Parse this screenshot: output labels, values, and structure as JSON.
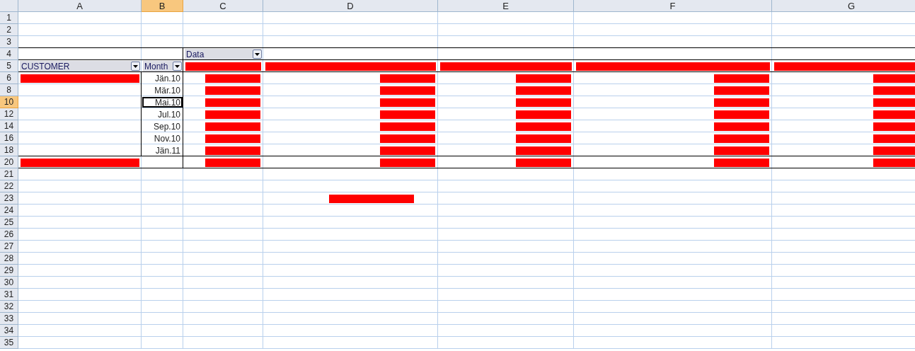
{
  "columns": [
    {
      "label": "A",
      "selected": false
    },
    {
      "label": "B",
      "selected": true
    },
    {
      "label": "C",
      "selected": false
    },
    {
      "label": "D",
      "selected": false
    },
    {
      "label": "E",
      "selected": false
    },
    {
      "label": "F",
      "selected": false
    },
    {
      "label": "G",
      "selected": false
    }
  ],
  "rows": [
    {
      "number": "1",
      "selected": false
    },
    {
      "number": "2",
      "selected": false
    },
    {
      "number": "3",
      "selected": false
    },
    {
      "number": "4",
      "selected": false,
      "cells": [
        null,
        null,
        {
          "kind": "field",
          "text": "Data",
          "selected": false
        }
      ]
    },
    {
      "number": "5",
      "selected": false,
      "cells": [
        {
          "kind": "field",
          "text": "CUSTOMER",
          "selected": false
        },
        {
          "kind": "field",
          "text": "Month",
          "selected": false
        },
        {
          "kind": "redacted",
          "selected": false
        },
        {
          "kind": "redacted",
          "selected": false
        },
        {
          "kind": "redacted",
          "selected": false
        },
        {
          "kind": "redacted",
          "selected": false
        },
        {
          "kind": "redacted",
          "selected": false
        }
      ]
    },
    {
      "number": "6",
      "selected": false,
      "cells": [
        {
          "kind": "redacted",
          "selected": false
        },
        {
          "kind": "date",
          "text": "Jän.10",
          "selected": false
        },
        {
          "kind": "redacted",
          "selected": false
        },
        {
          "kind": "redacted",
          "selected": false
        },
        {
          "kind": "redacted",
          "selected": false
        },
        {
          "kind": "redacted",
          "selected": false
        },
        {
          "kind": "redacted",
          "selected": false
        }
      ]
    },
    {
      "number": "8",
      "selected": false,
      "cells": [
        null,
        {
          "kind": "date",
          "text": "Mär.10",
          "selected": false
        },
        {
          "kind": "redacted",
          "selected": false
        },
        {
          "kind": "redacted",
          "selected": false
        },
        {
          "kind": "redacted",
          "selected": false
        },
        {
          "kind": "redacted",
          "selected": false
        },
        {
          "kind": "redacted",
          "selected": false
        }
      ]
    },
    {
      "number": "10",
      "selected": true,
      "cells": [
        null,
        {
          "kind": "date",
          "text": "Mai.10",
          "selected": true
        },
        {
          "kind": "redacted",
          "selected": false
        },
        {
          "kind": "redacted",
          "selected": false
        },
        {
          "kind": "redacted",
          "selected": false
        },
        {
          "kind": "redacted",
          "selected": false
        },
        {
          "kind": "redacted",
          "selected": false
        }
      ]
    },
    {
      "number": "12",
      "selected": false,
      "cells": [
        null,
        {
          "kind": "date",
          "text": "Jul.10",
          "selected": false
        },
        {
          "kind": "redacted",
          "selected": false
        },
        {
          "kind": "redacted",
          "selected": false
        },
        {
          "kind": "redacted",
          "selected": false
        },
        {
          "kind": "redacted",
          "selected": false
        },
        {
          "kind": "redacted",
          "selected": false
        }
      ]
    },
    {
      "number": "14",
      "selected": false,
      "cells": [
        null,
        {
          "kind": "date",
          "text": "Sep.10",
          "selected": false
        },
        {
          "kind": "redacted",
          "selected": false
        },
        {
          "kind": "redacted",
          "selected": false
        },
        {
          "kind": "redacted",
          "selected": false
        },
        {
          "kind": "redacted",
          "selected": false
        },
        {
          "kind": "redacted",
          "selected": false
        }
      ]
    },
    {
      "number": "16",
      "selected": false,
      "cells": [
        null,
        {
          "kind": "date",
          "text": "Nov.10",
          "selected": false
        },
        {
          "kind": "redacted",
          "selected": false
        },
        {
          "kind": "redacted",
          "selected": false
        },
        {
          "kind": "redacted",
          "selected": false
        },
        {
          "kind": "redacted",
          "selected": false
        },
        {
          "kind": "redacted",
          "selected": false
        }
      ]
    },
    {
      "number": "18",
      "selected": false,
      "cells": [
        null,
        {
          "kind": "date",
          "text": "Jän.11",
          "selected": false
        },
        {
          "kind": "redacted",
          "selected": false
        },
        {
          "kind": "redacted",
          "selected": false
        },
        {
          "kind": "redacted",
          "selected": false
        },
        {
          "kind": "redacted",
          "selected": false
        },
        {
          "kind": "redacted",
          "selected": false
        }
      ]
    },
    {
      "number": "20",
      "selected": false,
      "cells": [
        {
          "kind": "redacted",
          "selected": false
        },
        null,
        {
          "kind": "redacted",
          "selected": false
        },
        {
          "kind": "redacted",
          "selected": false
        },
        {
          "kind": "redacted",
          "selected": false
        },
        {
          "kind": "redacted",
          "selected": false
        },
        {
          "kind": "redacted",
          "selected": false
        }
      ]
    },
    {
      "number": "21",
      "selected": false
    },
    {
      "number": "22",
      "selected": false
    },
    {
      "number": "23",
      "selected": false,
      "cells": [
        null,
        null,
        null,
        {
          "kind": "redacted",
          "selected": false
        }
      ]
    },
    {
      "number": "24",
      "selected": false
    },
    {
      "number": "25",
      "selected": false
    },
    {
      "number": "26",
      "selected": false
    },
    {
      "number": "27",
      "selected": false
    },
    {
      "number": "28",
      "selected": false
    },
    {
      "number": "29",
      "selected": false
    },
    {
      "number": "30",
      "selected": false
    },
    {
      "number": "31",
      "selected": false
    },
    {
      "number": "32",
      "selected": false
    },
    {
      "number": "33",
      "selected": false
    },
    {
      "number": "34",
      "selected": false
    },
    {
      "number": "35",
      "selected": false
    }
  ]
}
